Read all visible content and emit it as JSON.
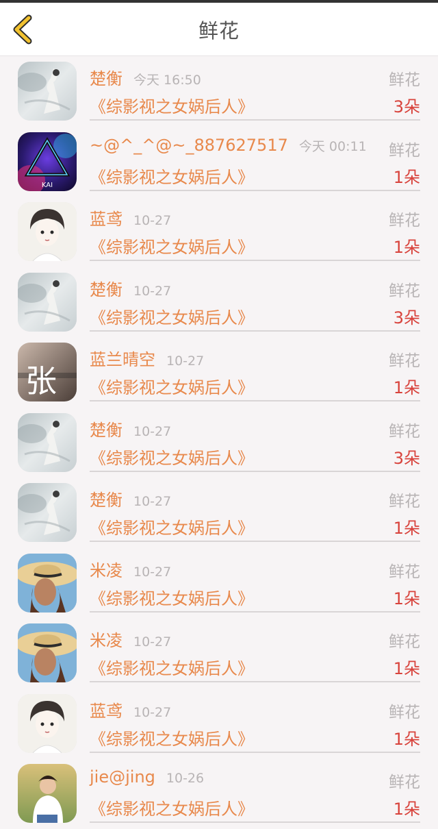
{
  "header": {
    "title": "鲜花",
    "back_icon": "chevron-left-icon",
    "accent": "#f2c230"
  },
  "colors": {
    "name": "#e8894c",
    "time": "#b8b4b5",
    "count": "#d8433c"
  },
  "rows": [
    {
      "name": "楚衡",
      "time": "今天 16:50",
      "kind": "鲜花",
      "book": "《综影视之女娲后人》",
      "count": "3朵",
      "avatar": "ink-painting-avatar"
    },
    {
      "name": "~@^_^@~_887627517",
      "time": "今天 00:11",
      "kind": "鲜花",
      "book": "《综影视之女娲后人》",
      "count": "1朵",
      "avatar": "neon-triangle-avatar",
      "avatar_text": "KAI"
    },
    {
      "name": "蓝鸢",
      "time": "10-27",
      "kind": "鲜花",
      "book": "《综影视之女娲后人》",
      "count": "1朵",
      "avatar": "sketch-girl-avatar"
    },
    {
      "name": "楚衡",
      "time": "10-27",
      "kind": "鲜花",
      "book": "《综影视之女娲后人》",
      "count": "3朵",
      "avatar": "ink-painting-avatar"
    },
    {
      "name": "蓝兰晴空",
      "time": "10-27",
      "kind": "鲜花",
      "book": "《综影视之女娲后人》",
      "count": "1朵",
      "avatar": "zhang-char-avatar",
      "avatar_text": "张"
    },
    {
      "name": "楚衡",
      "time": "10-27",
      "kind": "鲜花",
      "book": "《综影视之女娲后人》",
      "count": "3朵",
      "avatar": "ink-painting-avatar"
    },
    {
      "name": "楚衡",
      "time": "10-27",
      "kind": "鲜花",
      "book": "《综影视之女娲后人》",
      "count": "1朵",
      "avatar": "ink-painting-avatar"
    },
    {
      "name": "米凌",
      "time": "10-27",
      "kind": "鲜花",
      "book": "《综影视之女娲后人》",
      "count": "1朵",
      "avatar": "straw-hat-avatar"
    },
    {
      "name": "米凌",
      "time": "10-27",
      "kind": "鲜花",
      "book": "《综影视之女娲后人》",
      "count": "1朵",
      "avatar": "straw-hat-avatar"
    },
    {
      "name": "蓝鸢",
      "time": "10-27",
      "kind": "鲜花",
      "book": "《综影视之女娲后人》",
      "count": "1朵",
      "avatar": "sketch-girl-avatar"
    },
    {
      "name": "jie@jing",
      "time": "10-26",
      "kind": "鲜花",
      "book": "《综影视之女娲后人》",
      "count": "1朵",
      "avatar": "photo-girl-avatar"
    }
  ]
}
